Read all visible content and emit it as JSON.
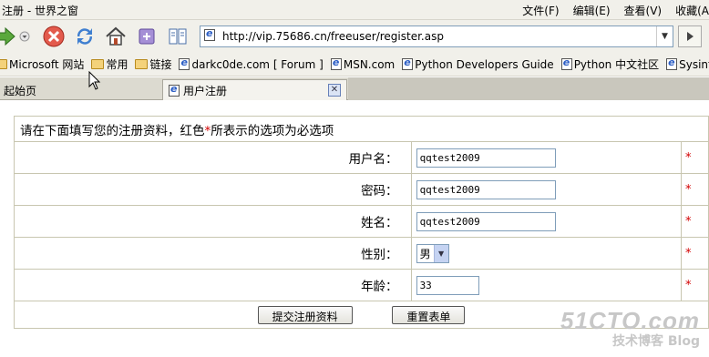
{
  "window": {
    "title": "注册 - 世界之窗",
    "menu": [
      "文件(F)",
      "编辑(E)",
      "查看(V)",
      "收藏(A"
    ]
  },
  "toolbar": {
    "icons": [
      "forward-icon",
      "dropdown-icon",
      "stop-icon",
      "refresh-icon",
      "home-icon",
      "history-icon",
      "bookmarks-icon"
    ],
    "address_url": "http://vip.75686.cn/freeuser/register.asp"
  },
  "bookmarks": [
    {
      "label": "Microsoft 网站",
      "icon": "folder"
    },
    {
      "label": "常用",
      "icon": "folder"
    },
    {
      "label": "链接",
      "icon": "folder"
    },
    {
      "label": "darkc0de.com [ Forum ]",
      "icon": "page"
    },
    {
      "label": "MSN.com",
      "icon": "page"
    },
    {
      "label": "Python Developers Guide",
      "icon": "page"
    },
    {
      "label": "Python 中文社区",
      "icon": "page"
    },
    {
      "label": "Sysinte",
      "icon": "page"
    }
  ],
  "tabs": [
    {
      "label": "起始页",
      "active": false
    },
    {
      "label": "用户注册",
      "active": true
    }
  ],
  "form": {
    "intro_prefix": "请在下面填写您的注册资料，红色",
    "intro_mark": "*",
    "intro_suffix": "所表示的选项为必选项",
    "required_mark": "*",
    "fields": {
      "username": {
        "label": "用户名：",
        "value": "qqtest2009"
      },
      "password": {
        "label": "密码：",
        "value": "qqtest2009"
      },
      "realname": {
        "label": "姓名：",
        "value": "qqtest2009"
      },
      "gender": {
        "label": "性别：",
        "value": "男"
      },
      "age": {
        "label": "年龄：",
        "value": "33"
      }
    },
    "submit_label": "提交注册资料",
    "reset_label": "重置表单"
  },
  "watermark": {
    "main": "51CTO.com",
    "sub": "技术博客  Blog"
  },
  "colors": {
    "required": "#d20000",
    "chrome": "#f1f0ea"
  }
}
